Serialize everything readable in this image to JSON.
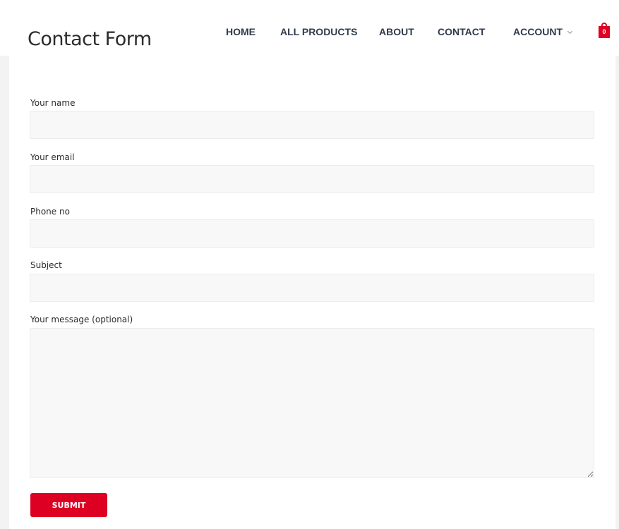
{
  "header": {
    "site_title": "Contact Form",
    "nav": [
      {
        "label": "HOME"
      },
      {
        "label": "ALL PRODUCTS"
      },
      {
        "label": "ABOUT"
      },
      {
        "label": "CONTACT"
      },
      {
        "label": "ACCOUNT",
        "has_dropdown": true
      }
    ],
    "cart": {
      "count": "0",
      "icon": "shopping-bag-icon"
    }
  },
  "form": {
    "fields": [
      {
        "label": "Your name",
        "value": "",
        "placeholder": ""
      },
      {
        "label": "Your email",
        "value": "",
        "placeholder": ""
      },
      {
        "label": "Phone no",
        "value": "",
        "placeholder": ""
      },
      {
        "label": "Subject",
        "value": "",
        "placeholder": ""
      },
      {
        "label": "Your message (optional)",
        "value": "",
        "placeholder": ""
      }
    ],
    "submit_label": "SUBMIT"
  },
  "colors": {
    "accent": "#dd0022",
    "nav_text": "#2f3b4c",
    "page_bg": "#f3f3f3",
    "field_bg": "#f8f8f8"
  }
}
